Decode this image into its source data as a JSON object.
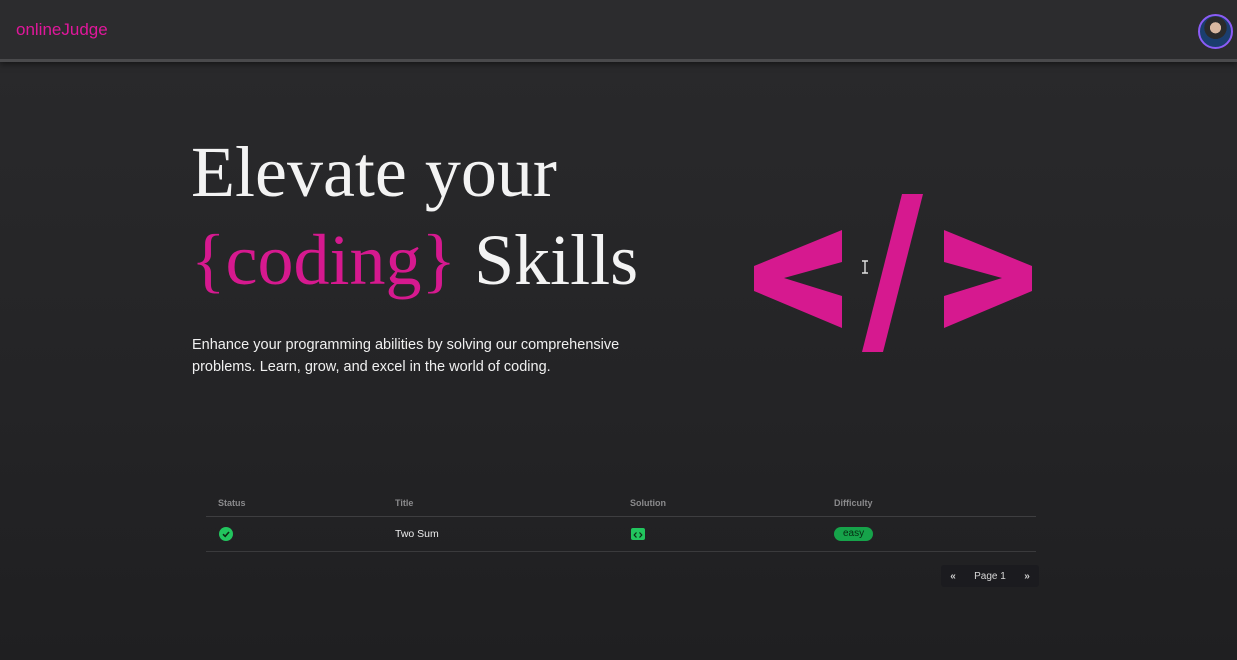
{
  "navbar": {
    "brand": "onlineJudge",
    "avatar_icon": "user-avatar-icon"
  },
  "hero": {
    "line1": "Elevate your",
    "accent": "{coding}",
    "line2_rest": " Skills",
    "description": "Enhance your programming abilities by solving our comprehensive problems. Learn, grow, and excel in the world of coding.",
    "graphic_icon": "code-tag-icon"
  },
  "table": {
    "headers": [
      "Status",
      "Title",
      "Solution",
      "Difficulty"
    ],
    "rows": [
      {
        "status_icon": "check-circle-icon",
        "title": "Two Sum",
        "solution_icon": "code-icon",
        "difficulty": "easy"
      }
    ]
  },
  "pagination": {
    "prev": "«",
    "label": "Page 1",
    "next": "»"
  },
  "colors": {
    "accent": "#d6198f",
    "brand": "#e0179b",
    "success": "#22c55e",
    "background": "#262628"
  }
}
